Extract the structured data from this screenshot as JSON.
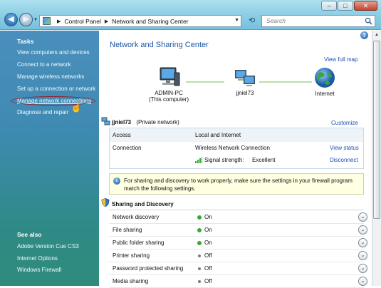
{
  "window": {
    "minimize_label": "–",
    "maximize_label": "□",
    "close_label": "✕"
  },
  "address_bar": {
    "back_glyph": "◀",
    "forward_glyph": "▶",
    "separator": "▶",
    "crumbs": [
      "Control Panel",
      "Network and Sharing Center"
    ],
    "dropdown_glyph": "▼",
    "refresh_glyph": "⟲"
  },
  "search": {
    "placeholder": "Search"
  },
  "left_pane": {
    "tasks_heading": "Tasks",
    "tasks": [
      "View computers and devices",
      "Connect to a network",
      "Manage wireless networks",
      "Set up a connection or network",
      "Manage network connections",
      "Diagnose and repair"
    ],
    "see_also_heading": "See also",
    "see_also": [
      "Adobe Version Cue CS3",
      "Internet Options",
      "Windows Firewall"
    ]
  },
  "main": {
    "help_glyph": "?",
    "title": "Network and Sharing Center",
    "view_full_map": "View full map",
    "map": {
      "computer_name": "ADMIN-PC",
      "computer_sub": "(This computer)",
      "network_name": "jjniel73",
      "internet_label": "Internet"
    },
    "network": {
      "name": "jjniel73",
      "type": "(Private network)",
      "customize": "Customize",
      "rows": {
        "access_label": "Access",
        "access_value": "Local and Internet",
        "connection_label": "Connection",
        "connection_value": "Wireless Network Connection",
        "view_status": "View status",
        "signal_label": "Signal strength:",
        "signal_value": "Excellent",
        "disconnect": "Disconnect"
      }
    },
    "info": {
      "icon_glyph": "i",
      "text": "For sharing and discovery to work properly, make sure the settings in your firewall program match the following settings."
    },
    "sharing": {
      "heading": "Sharing and Discovery",
      "rows": [
        {
          "label": "Network discovery",
          "state": "On",
          "on": true
        },
        {
          "label": "File sharing",
          "state": "On",
          "on": true
        },
        {
          "label": "Public folder sharing",
          "state": "On",
          "on": true
        },
        {
          "label": "Printer sharing",
          "state": "Off",
          "on": false
        },
        {
          "label": "Password protected sharing",
          "state": "Off",
          "on": false
        },
        {
          "label": "Media sharing",
          "state": "Off",
          "on": false
        }
      ],
      "expand_glyph": "⌄"
    },
    "colors": {
      "on_dot": "#3aa63a",
      "off_dot": "#7a7a7a",
      "link": "#1a4fb5",
      "title": "#1f55a5"
    }
  }
}
